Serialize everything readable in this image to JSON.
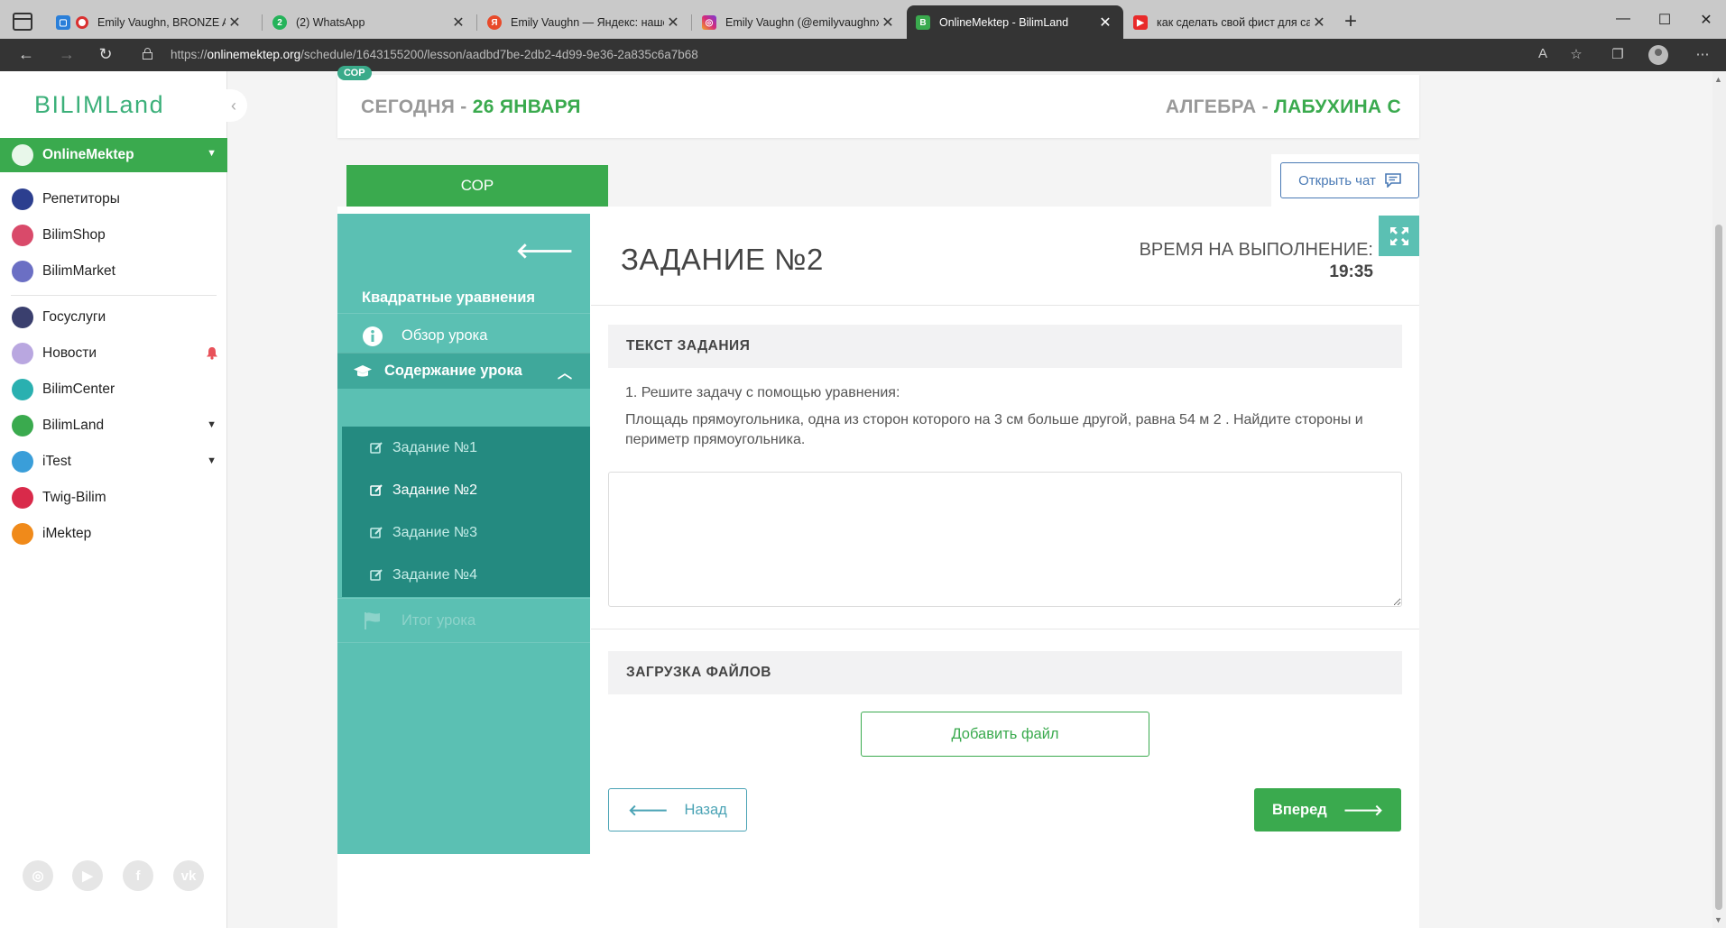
{
  "browser": {
    "tabs": [
      {
        "title": "Emily Vaughn, BRONZE AVE",
        "close": "✕"
      },
      {
        "title": "(2) WhatsApp",
        "close": "✕"
      },
      {
        "title": "Emily Vaughn — Яндекс: нашёл",
        "close": "✕"
      },
      {
        "title": "Emily Vaughn (@emilyvaughnx)",
        "close": "✕"
      },
      {
        "title": "OnlineMektep - BilimLand",
        "close": "✕"
      },
      {
        "title": "как сделать свой фист для сам",
        "close": "✕"
      }
    ],
    "new_tab": "+",
    "url_prefix": "https://",
    "url_domain": "onlinemektep.org",
    "url_path": "/schedule/1643155200/lesson/aadbd7be-2db2-4d99-9e36-2a835c6a7b68"
  },
  "sidebar": {
    "logo": "BILIMLand",
    "active_item": "OnlineMektep",
    "items": [
      {
        "label": "Репетиторы",
        "color": "#2c3f8f"
      },
      {
        "label": "BilimShop",
        "color": "#d94a6a"
      },
      {
        "label": "BilimMarket",
        "color": "#6b6fc4"
      },
      {
        "label": "Госуслуги",
        "color": "#3a3f6e"
      },
      {
        "label": "Новости",
        "color": "#b9a7e0"
      },
      {
        "label": "BilimCenter",
        "color": "#2ab0b0"
      },
      {
        "label": "BilimLand",
        "color": "#3aaa4e"
      },
      {
        "label": "iTest",
        "color": "#3a9ed9"
      },
      {
        "label": "Twig-Bilim",
        "color": "#d92a4a"
      },
      {
        "label": "iMektep",
        "color": "#f08a1a"
      }
    ]
  },
  "header": {
    "badge": "СОР",
    "today_label": "СЕГОДНЯ - ",
    "date": "26 ЯНВАРЯ",
    "subject": "АЛГЕБРА - ",
    "teacher": "ЛАБУХИНА С"
  },
  "lesson": {
    "tab_label": "СОР",
    "chat_button": "Открыть чат",
    "topic": "Квадратные уравнения",
    "overview": "Обзор урока",
    "content": "Содержание урока",
    "tasks": [
      "Задание №1",
      "Задание №2",
      "Задание №3",
      "Задание №4"
    ],
    "summary": "Итог урока"
  },
  "task": {
    "title": "ЗАДАНИЕ №2",
    "time_label": "ВРЕМЯ НА ВЫПОЛНЕНИЕ:",
    "time_value": "19:35",
    "text_heading": "ТЕКСТ ЗАДАНИЯ",
    "line1": "1. Решите задачу с помощью уравнения:",
    "line2": "Площадь прямоугольника, одна из сторон которого на 3 см больше другой, равна 54 м 2 . Найдите стороны и периметр прямоугольника.",
    "upload_heading": "ЗАГРУЗКА ФАЙЛОВ",
    "add_file": "Добавить файл",
    "back": "Назад",
    "forward": "Вперед"
  },
  "colors": {
    "brand_green": "#3aaa4e",
    "teal": "#5bc0b3",
    "dark_teal": "#248a80"
  }
}
